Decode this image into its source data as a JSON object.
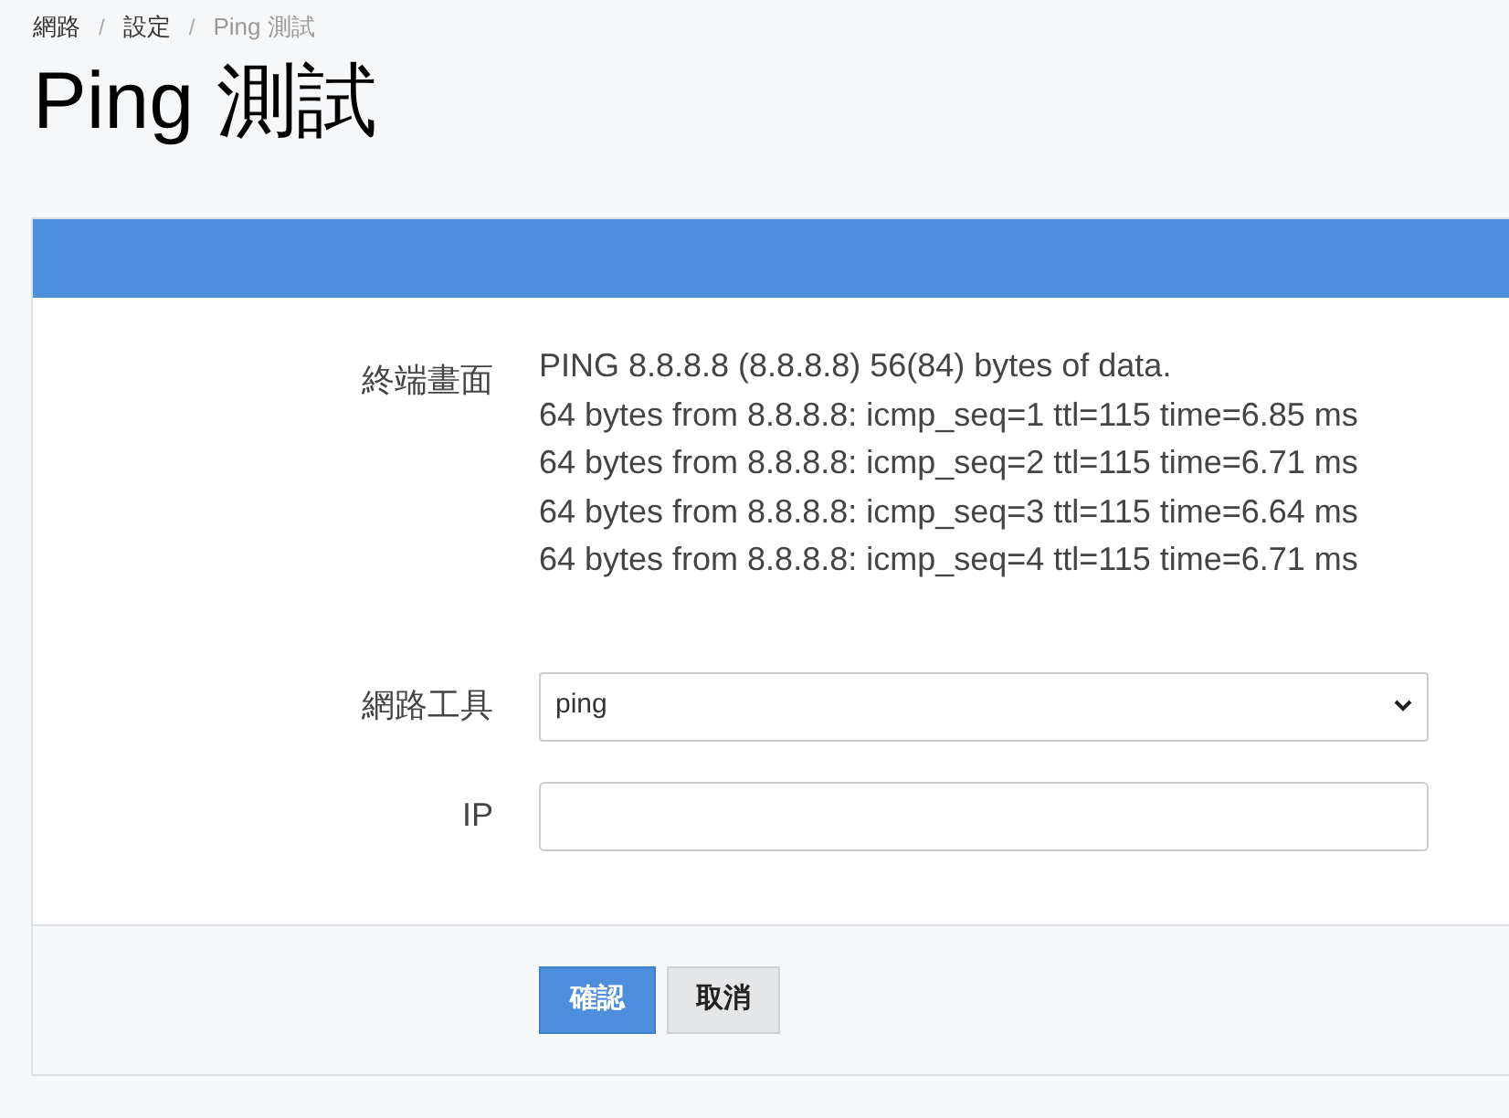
{
  "breadcrumb": [
    {
      "label": "網路",
      "current": false
    },
    {
      "separator": "/",
      "label": "設定",
      "current": false
    },
    {
      "separator": "/",
      "label": "Ping 測試",
      "current": true
    }
  ],
  "title": "Ping 測試",
  "terminal": {
    "label": "終端畫面",
    "lines": [
      "PING 8.8.8.8 (8.8.8.8) 56(84) bytes of data.",
      "64 bytes from 8.8.8.8: icmp_seq=1 ttl=115 time=6.85 ms",
      "64 bytes from 8.8.8.8: icmp_seq=2 ttl=115 time=6.71 ms",
      "64 bytes from 8.8.8.8: icmp_seq=3 ttl=115 time=6.64 ms",
      "64 bytes from 8.8.8.8: icmp_seq=4 ttl=115 time=6.71 ms"
    ]
  },
  "fields": [
    {
      "kind": "select",
      "label": "網路工具",
      "value": "ping"
    },
    {
      "kind": "text",
      "label": "IP"
    }
  ],
  "buttons": [
    {
      "kind": "primary",
      "label": "確認"
    },
    {
      "kind": "default",
      "label": "取消"
    }
  ]
}
